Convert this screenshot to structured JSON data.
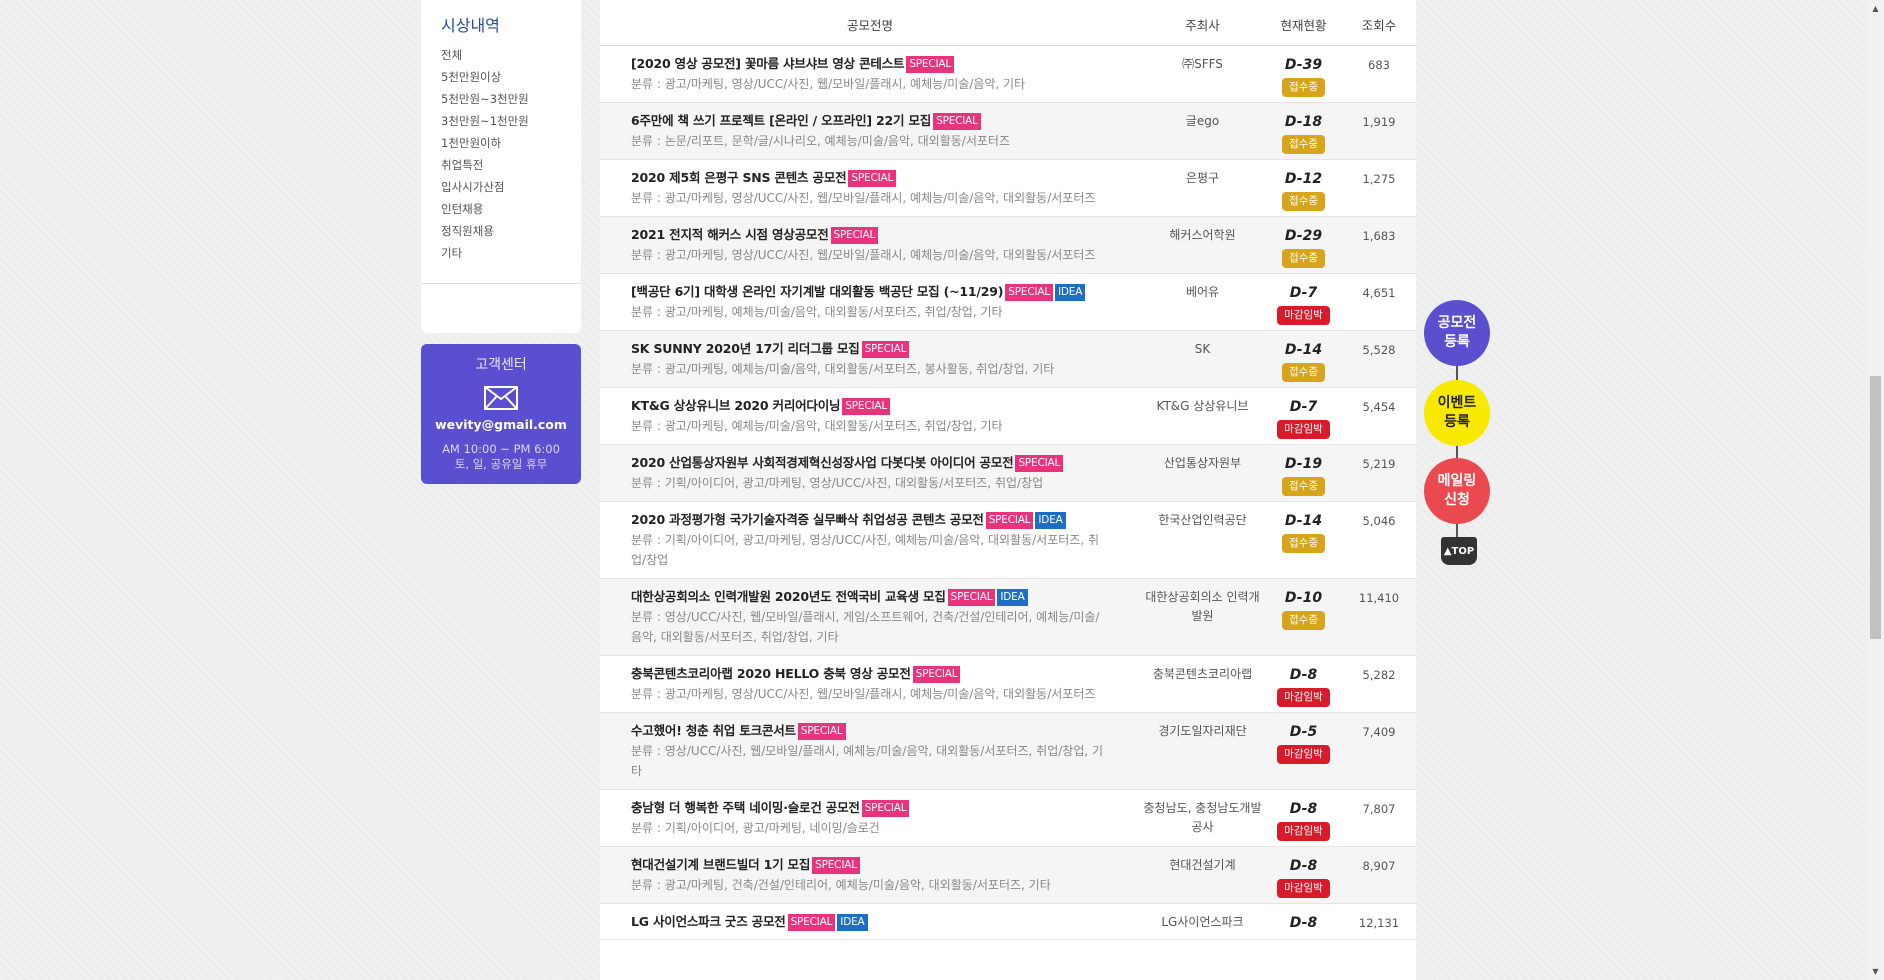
{
  "sidebar": {
    "title": "시상내역",
    "items": [
      "전체",
      "5천만원이상",
      "5천만원~3천만원",
      "3천만원~1천만원",
      "1천만원이하",
      "취업특전",
      "입사시가산점",
      "인턴채용",
      "정직원채용",
      "기타"
    ]
  },
  "customer_center": {
    "title": "고객센터",
    "icon": "mail-icon",
    "email": "wevity@gmail.com",
    "hours": "AM 10:00 ~ PM 6:00",
    "closed": "토, 일, 공유일 휴무"
  },
  "table": {
    "headers": {
      "title": "공모전명",
      "host": "주최사",
      "status": "현재현황",
      "views": "조회수"
    },
    "rows": [
      {
        "title": "[2020 영상 공모전] 꽃마름 샤브샤브 영상 콘테스트",
        "badges": [
          "SPECIAL"
        ],
        "category": "분류 : 광고/마케팅, 영상/UCC/사진, 웹/모바일/플래시, 예체능/미술/음악, 기타",
        "host": "㈜SFFS",
        "dday": "D-39",
        "status": "접수중",
        "status_type": "open",
        "views": "683"
      },
      {
        "title": "6주만에 책 쓰기 프로젝트 [온라인 / 오프라인] 22기 모집",
        "badges": [
          "SPECIAL"
        ],
        "category": "분류 : 논문/리포트, 문학/글/시나리오, 예체능/미술/음악, 대외활동/서포터즈",
        "host": "글ego",
        "dday": "D-18",
        "status": "접수중",
        "status_type": "open",
        "views": "1,919"
      },
      {
        "title": "2020 제5회 은평구 SNS 콘텐츠 공모전",
        "badges": [
          "SPECIAL"
        ],
        "category": "분류 : 광고/마케팅, 영상/UCC/사진, 웹/모바일/플래시, 예체능/미술/음악, 대외활동/서포터즈",
        "host": "은평구",
        "dday": "D-12",
        "status": "접수중",
        "status_type": "open",
        "views": "1,275"
      },
      {
        "title": "2021 전지적 해커스 시점 영상공모전",
        "badges": [
          "SPECIAL"
        ],
        "category": "분류 : 광고/마케팅, 영상/UCC/사진, 웹/모바일/플래시, 예체능/미술/음악, 대외활동/서포터즈",
        "host": "해커스어학원",
        "dday": "D-29",
        "status": "접수중",
        "status_type": "open",
        "views": "1,683"
      },
      {
        "title": "[백공단 6기] 대학생 온라인 자기계발 대외활동 백공단 모집 (~11/29)",
        "badges": [
          "SPECIAL",
          "IDEA"
        ],
        "category": "분류 : 광고/마케팅, 예체능/미술/음악, 대외활동/서포터즈, 취업/창업, 기타",
        "host": "베어유",
        "dday": "D-7",
        "status": "마감임박",
        "status_type": "soon",
        "views": "4,651"
      },
      {
        "title": "SK SUNNY 2020년 17기 리더그룹 모집",
        "badges": [
          "SPECIAL"
        ],
        "category": "분류 : 광고/마케팅, 예체능/미술/음악, 대외활동/서포터즈, 봉사활동, 취업/창업, 기타",
        "host": "SK",
        "dday": "D-14",
        "status": "접수중",
        "status_type": "open",
        "views": "5,528"
      },
      {
        "title": "KT&G 상상유니브 2020 커리어다이닝",
        "badges": [
          "SPECIAL"
        ],
        "category": "분류 : 광고/마케팅, 예체능/미술/음악, 대외활동/서포터즈, 취업/창업, 기타",
        "host": "KT&G 상상유니브",
        "dday": "D-7",
        "status": "마감임박",
        "status_type": "soon",
        "views": "5,454"
      },
      {
        "title": "2020 산업통상자원부 사회적경제혁신성장사업 다봇다봇 아이디어 공모전",
        "badges": [
          "SPECIAL"
        ],
        "category": "분류 : 기획/아이디어, 광고/마케팅, 영상/UCC/사진, 대외활동/서포터즈, 취업/창업",
        "host": "산업통상자원부",
        "dday": "D-19",
        "status": "접수중",
        "status_type": "open",
        "views": "5,219"
      },
      {
        "title": "2020 과정평가형 국가기술자격증 실무빠삭 취업성공 콘텐츠 공모전",
        "badges": [
          "SPECIAL",
          "IDEA"
        ],
        "category": "분류 : 기획/아이디어, 광고/마케팅, 영상/UCC/사진, 예체능/미술/음악, 대외활동/서포터즈, 취업/창업",
        "host": "한국산업인력공단",
        "dday": "D-14",
        "status": "접수중",
        "status_type": "open",
        "views": "5,046"
      },
      {
        "title": "대한상공회의소 인력개발원 2020년도 전액국비 교육생 모집",
        "badges": [
          "SPECIAL",
          "IDEA"
        ],
        "category": "분류 : 영상/UCC/사진, 웹/모바일/플래시, 게임/소프트웨어, 건축/건설/인테리어, 예체능/미술/음악, 대외활동/서포터즈, 취업/창업, 기타",
        "host": "대한상공회의소 인력개발원",
        "dday": "D-10",
        "status": "접수중",
        "status_type": "open",
        "views": "11,410"
      },
      {
        "title": "충북콘텐츠코리아랩 2020 HELLO 충북 영상 공모전",
        "badges": [
          "SPECIAL"
        ],
        "category": "분류 : 광고/마케팅, 영상/UCC/사진, 웹/모바일/플래시, 예체능/미술/음악, 대외활동/서포터즈",
        "host": "충북콘텐츠코리아랩",
        "dday": "D-8",
        "status": "마감임박",
        "status_type": "soon",
        "views": "5,282"
      },
      {
        "title": "수고했어! 청춘 취업 토크콘서트",
        "badges": [
          "SPECIAL"
        ],
        "category": "분류 : 영상/UCC/사진, 웹/모바일/플래시, 예체능/미술/음악, 대외활동/서포터즈, 취업/창업, 기타",
        "host": "경기도일자리재단",
        "dday": "D-5",
        "status": "마감임박",
        "status_type": "soon",
        "views": "7,409"
      },
      {
        "title": "충남형 더 행복한 주택 네이밍·슬로건 공모전",
        "badges": [
          "SPECIAL"
        ],
        "category": "분류 : 기획/아이디어, 광고/마케팅, 네이밍/슬로건",
        "host": "충청남도, 충청남도개발공사",
        "dday": "D-8",
        "status": "마감임박",
        "status_type": "soon",
        "views": "7,807"
      },
      {
        "title": "현대건설기계 브랜드빌더 1기 모집",
        "badges": [
          "SPECIAL"
        ],
        "category": "분류 : 광고/마케팅, 건축/건설/인테리어, 예체능/미술/음악, 대외활동/서포터즈, 기타",
        "host": "현대건설기계",
        "dday": "D-8",
        "status": "마감임박",
        "status_type": "soon",
        "views": "8,907"
      },
      {
        "title": "LG 사이언스파크 굿즈 공모전",
        "badges": [
          "SPECIAL",
          "IDEA"
        ],
        "category": "",
        "host": "LG사이언스파크",
        "dday": "D-8",
        "status": "",
        "status_type": "none",
        "views": "12,131"
      }
    ]
  },
  "floating_menu": {
    "register_contest": "공모전\n등록",
    "register_event": "이벤트\n등록",
    "mailing": "메일링\n신청",
    "top": "▲TOP"
  },
  "colors": {
    "accent_purple": "#5a4fcf",
    "special": "#e8337d",
    "idea": "#1c6fc4",
    "open": "#d7a51c",
    "closing": "#d81b2a"
  }
}
